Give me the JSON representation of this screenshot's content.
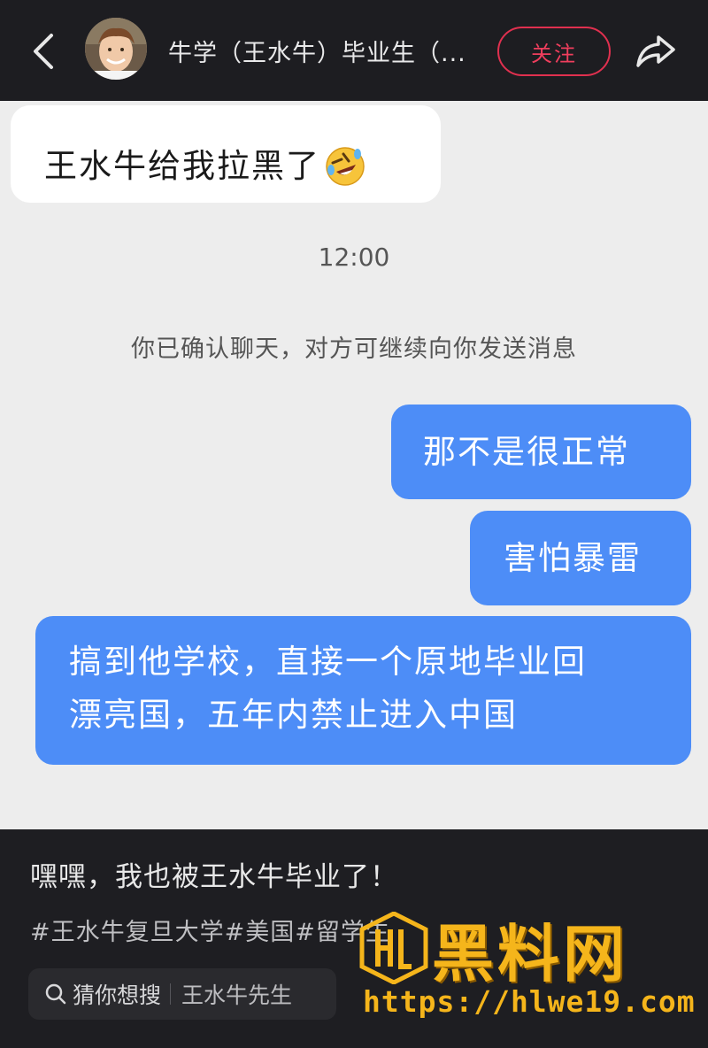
{
  "header": {
    "title": "牛学（王水牛）毕业生（...",
    "follow_label": "关注"
  },
  "chat": {
    "incoming": [
      {
        "text": "王水牛给我拉黑了",
        "emoji": "rolling-on-floor-laughing"
      }
    ],
    "timestamp": "12:00",
    "system_notice": "你已确认聊天，对方可继续向你发送消息",
    "outgoing": [
      {
        "text": "那不是很正常"
      },
      {
        "text": "害怕暴雷"
      },
      {
        "line1": "搞到他学校，直接一个原地毕业回",
        "line2": "漂亮国，五年内禁止进入中国"
      }
    ]
  },
  "post": {
    "caption": "嘿嘿，我也被王水牛毕业了！",
    "hashtags": [
      "#王水牛复旦大学",
      "#美国",
      "#留学生"
    ],
    "search_label": "猜你想搜",
    "search_term": "王水牛先生"
  },
  "watermark": {
    "brand": "黑料网",
    "url": "https://hlwe19.com"
  },
  "colors": {
    "accent_red": "#e0304f",
    "bubble_blue": "#4d8df7",
    "watermark_gold": "#f5b51b"
  }
}
